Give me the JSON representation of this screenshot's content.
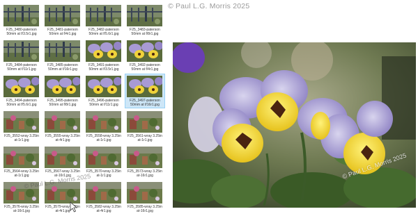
{
  "header": {
    "credit": "© Paul L.G. Morris 2025"
  },
  "preview": {
    "credit": "© Paul L.G. Morris 2025"
  },
  "hover_tip": "© Paul L.G. Morris 2025",
  "colors": {
    "selection_bg": "#cde6f7",
    "selection_border": "#99d1f5",
    "caption": "#333333"
  },
  "thumbnails": [
    {
      "line1": "F25_3480-paterson",
      "line2": "50mm at f/3.5r1.jpg",
      "scene": "fence"
    },
    {
      "line1": "F25_3481-paterson",
      "line2": "50mm at f/4r1.jpg",
      "scene": "fence"
    },
    {
      "line1": "F25_3482-paterson",
      "line2": "50mm at f/5.6r1.jpg",
      "scene": "fence"
    },
    {
      "line1": "F25_3483-paterson",
      "line2": "50mm at f/8r1.jpg",
      "scene": "fence"
    },
    {
      "line1": "F25_3484-paterson",
      "line2": "50mm at f/11r1.jpg",
      "scene": "fence"
    },
    {
      "line1": "F25_3485-paterson",
      "line2": "50mm at f/16r1.jpg",
      "scene": "fence"
    },
    {
      "line1": "F25_3491-paterson",
      "line2": "50mm at f/3.5r1.jpg",
      "scene": "pansy"
    },
    {
      "line1": "F25_3492-paterson",
      "line2": "50mm at f/4r1.jpg",
      "scene": "pansy"
    },
    {
      "line1": "F25_3494-paterson",
      "line2": "50mm at f/5.6r1.jpg",
      "scene": "pansy"
    },
    {
      "line1": "F25_3495-paterson",
      "line2": "50mm at f/8r1.jpg",
      "scene": "pansy"
    },
    {
      "line1": "F25_3496-paterson",
      "line2": "50mm at f/11r1.jpg",
      "scene": "pansy"
    },
    {
      "line1": "F25_3497-paterson",
      "line2": "50mm at f/16r1.jpg",
      "scene": "pansy",
      "selected": true
    },
    {
      "line1": "F25_3552-wray 3.25in",
      "line2": "at-1r1.jpg",
      "scene": "garden"
    },
    {
      "line1": "F25_3555-wray 3.25in",
      "line2": "at-4r1.jpg",
      "scene": "garden"
    },
    {
      "line1": "F25_3558-wray 3.25in",
      "line2": "at-1r1.jpg",
      "scene": "garden"
    },
    {
      "line1": "F25_3561-wray 3.25in",
      "line2": "at-1r1.jpg",
      "scene": "garden"
    },
    {
      "line1": "F25_3564-wray 3.25in",
      "line2": "at-1r1.jpg",
      "scene": "garden"
    },
    {
      "line1": "F25_3567-wray 3.25in",
      "line2": "at-16r1.jpg",
      "scene": "garden"
    },
    {
      "line1": "F25_3570-wray 3.25in",
      "line2": "at-1r1.jpg",
      "scene": "garden"
    },
    {
      "line1": "F25_3573-wray 3.25in",
      "line2": "at-16r1.jpg",
      "scene": "garden"
    },
    {
      "line1": "F25_3576-wray 3.25in",
      "line2": "at-16r1.jpg",
      "scene": "garden"
    },
    {
      "line1": "F25_3579-wray 3.25in",
      "line2": "at-4r1.jpg",
      "scene": "garden"
    },
    {
      "line1": "F25_3582-wray 3.25in",
      "line2": "at-4r1.jpg",
      "scene": "garden"
    },
    {
      "line1": "F25_3585-wray 3.25in",
      "line2": "at-16r1.jpg",
      "scene": "garden"
    }
  ]
}
